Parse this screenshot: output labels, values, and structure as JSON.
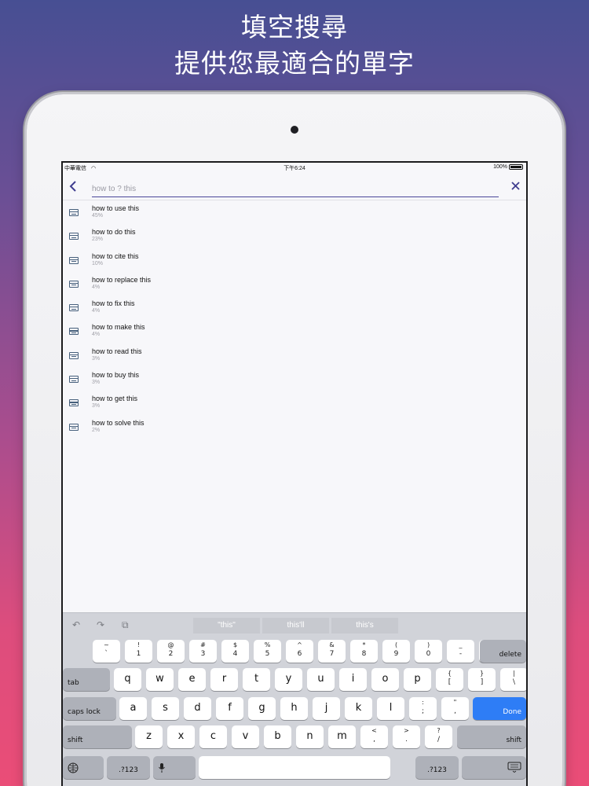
{
  "headline": {
    "line1": "填空搜尋",
    "line2": "提供您最適合的單字"
  },
  "status_bar": {
    "carrier": "中華電信",
    "time": "下午6:24",
    "battery": "100%"
  },
  "search": {
    "placeholder": "how to ? this"
  },
  "results": [
    {
      "term": "how to use this",
      "percent": "45%"
    },
    {
      "term": "how to do this",
      "percent": "23%"
    },
    {
      "term": "how to cite this",
      "percent": "10%"
    },
    {
      "term": "how to replace this",
      "percent": "4%"
    },
    {
      "term": "how to fix this",
      "percent": "4%"
    },
    {
      "term": "how to make this",
      "percent": "4%"
    },
    {
      "term": "how to read this",
      "percent": "3%"
    },
    {
      "term": "how to buy this",
      "percent": "3%"
    },
    {
      "term": "how to get this",
      "percent": "3%"
    },
    {
      "term": "how to solve this",
      "percent": "2%"
    }
  ],
  "keyboard": {
    "suggestions": [
      "\"this\"",
      "this'll",
      "this's"
    ],
    "row1": [
      {
        "top": "~",
        "bot": "`"
      },
      {
        "top": "!",
        "bot": "1"
      },
      {
        "top": "@",
        "bot": "2"
      },
      {
        "top": "#",
        "bot": "3"
      },
      {
        "top": "$",
        "bot": "4"
      },
      {
        "top": "%",
        "bot": "5"
      },
      {
        "top": "^",
        "bot": "6"
      },
      {
        "top": "&",
        "bot": "7"
      },
      {
        "top": "*",
        "bot": "8"
      },
      {
        "top": "(",
        "bot": "9"
      },
      {
        "top": ")",
        "bot": "0"
      },
      {
        "top": "_",
        "bot": "-"
      },
      {
        "top": "+",
        "bot": "="
      }
    ],
    "delete_label": "delete",
    "tab_label": "tab",
    "row2": [
      "q",
      "w",
      "e",
      "r",
      "t",
      "y",
      "u",
      "i",
      "o",
      "p"
    ],
    "row2_sym": [
      {
        "top": "{",
        "bot": "["
      },
      {
        "top": "}",
        "bot": "]"
      },
      {
        "top": "|",
        "bot": "\\"
      }
    ],
    "caps_label": "caps lock",
    "row3": [
      "a",
      "s",
      "d",
      "f",
      "g",
      "h",
      "j",
      "k",
      "l"
    ],
    "row3_sym": [
      {
        "top": ":",
        "bot": ";"
      },
      {
        "top": "\"",
        "bot": ","
      }
    ],
    "done_label": "Done",
    "shift_label": "shift",
    "row4": [
      "z",
      "x",
      "c",
      "v",
      "b",
      "n",
      "m"
    ],
    "row4_sym": [
      {
        "top": "<",
        "bot": ","
      },
      {
        "top": ">",
        "bot": "."
      },
      {
        "top": "?",
        "bot": "/"
      }
    ],
    "numbers_label": ".?123"
  }
}
